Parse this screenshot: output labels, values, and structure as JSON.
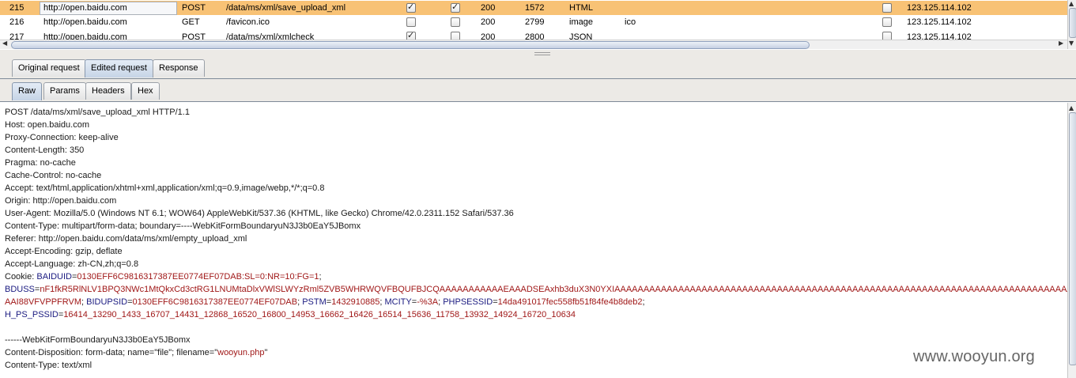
{
  "history": {
    "rows": [
      {
        "num": "215",
        "host": "http://open.baidu.com",
        "method": "POST",
        "url": "/data/ms/xml/save_upload_xml",
        "params": true,
        "edited": true,
        "status": "200",
        "length": "1572",
        "mime": "HTML",
        "ext": "",
        "comment": false,
        "ip": "123.125.114.102"
      },
      {
        "num": "216",
        "host": "http://open.baidu.com",
        "method": "GET",
        "url": "/favicon.ico",
        "params": false,
        "edited": false,
        "status": "200",
        "length": "2799",
        "mime": "image",
        "ext": "ico",
        "comment": false,
        "ip": "123.125.114.102"
      },
      {
        "num": "217",
        "host": "http://open.baidu.com",
        "method": "POST",
        "url": "/data/ms/xml/xmlcheck",
        "params": true,
        "edited": false,
        "status": "200",
        "length": "2800",
        "mime": "JSON",
        "ext": "",
        "comment": false,
        "ip": "123.125.114.102"
      }
    ]
  },
  "tabs": {
    "message": [
      "Original request",
      "Edited request",
      "Response"
    ],
    "message_selected": "Edited request",
    "view": [
      "Raw",
      "Params",
      "Headers",
      "Hex"
    ],
    "view_selected": "Raw"
  },
  "request": {
    "plain": [
      "POST /data/ms/xml/save_upload_xml HTTP/1.1",
      "Host: open.baidu.com",
      "Proxy-Connection: keep-alive",
      "Content-Length: 350",
      "Pragma: no-cache",
      "Cache-Control: no-cache",
      "Accept: text/html,application/xhtml+xml,application/xml;q=0.9,image/webp,*/*;q=0.8",
      "Origin: http://open.baidu.com",
      "User-Agent: Mozilla/5.0 (Windows NT 6.1; WOW64) AppleWebKit/537.36 (KHTML, like Gecko) Chrome/42.0.2311.152 Safari/537.36",
      "Content-Type: multipart/form-data; boundary=----WebKitFormBoundaryuN3J3b0EaY5JBomx",
      "Referer: http://open.baidu.com/data/ms/xml/empty_upload_xml",
      "Accept-Encoding: gzip, deflate",
      "Accept-Language: zh-CN,zh;q=0.8"
    ],
    "cookie_label": "Cookie: ",
    "cookies": {
      "baiduid_k": "BAIDUID",
      "baiduid_v": "0130EFF6C9816317387EE0774EF07DAB:SL=0:NR=10:FG=1",
      "bduss_k": "BDUSS",
      "bduss_v1": "nF1fkR5RlNLV1BPQ3NWc1MtQkxCd3ctRG1LNUMtaDlxVWlSLWYzRml5ZVB5WHRWQVFBQUFBJCQAAAAAAAAAAAEAAADSEAxhb3duX3N0YXIAAAAAAAAAAAAAAAAAAAAAAAAAAAAAAAAAAAAAAAAAAAAAAAAAAAAAAAAAAAAAAAAAAAAAAAAAAAAAAAAAAAAAAA",
      "bduss_v2": "AAI88VFVPPFRVM",
      "bidupsid_k": "BIDUPSID",
      "bidupsid_v": "0130EFF6C9816317387EE0774EF07DAB",
      "pstm_k": "PSTM",
      "pstm_v": "1432910885",
      "mcity_k": "MCITY",
      "mcity_v": "-%3A",
      "phpsessid_k": "PHPSESSID",
      "phpsessid_v": "14da491017fec558fb51f84fe4b8deb2",
      "hps_k": "H_PS_PSSID",
      "hps_v": "16414_13290_1433_16707_14431_12868_16520_16800_14953_16662_16426_16514_15636_11758_13932_14924_16720_10634"
    },
    "boundary": "------WebKitFormBoundaryuN3J3b0EaY5JBomx",
    "disposition_prefix": "Content-Disposition: form-data; name=\"file\"; filename=\"",
    "filename": "wooyun.php",
    "disposition_suffix": "\"",
    "content_type": "Content-Type: text/xml"
  },
  "watermark": "www.wooyun.org"
}
